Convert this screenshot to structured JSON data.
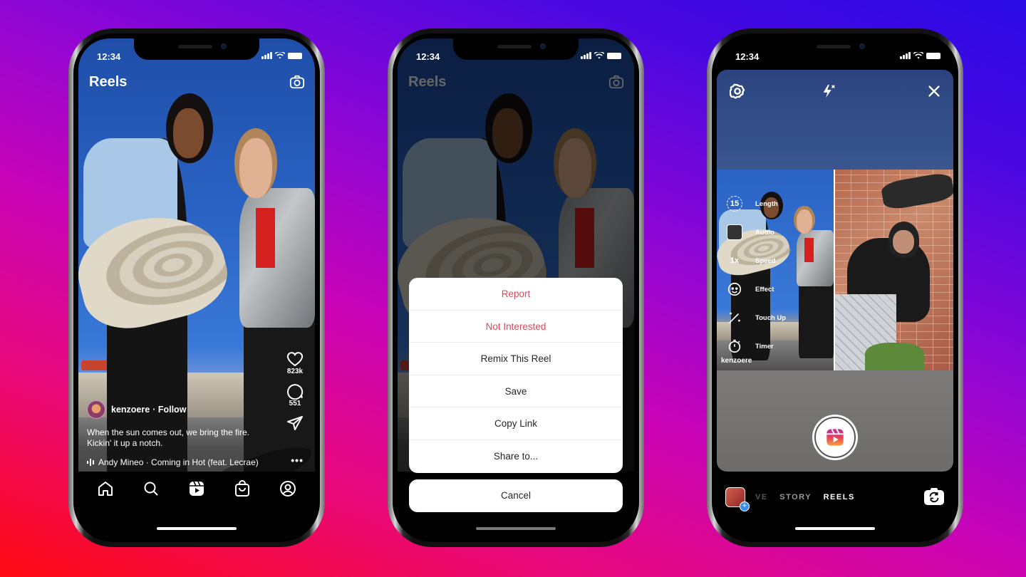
{
  "background": {
    "gradient_colors": [
      "#ff0a10",
      "#e8087a",
      "#c804b8",
      "#8a06d6",
      "#4a08e0",
      "#2a0ae6"
    ]
  },
  "phones": [
    {
      "status": {
        "time": "12:34"
      },
      "header": {
        "title": "Reels",
        "camera_icon": "camera-icon"
      },
      "actions": [
        {
          "icon": "heart-icon",
          "count": "823k"
        },
        {
          "icon": "comment-icon",
          "count": "551"
        },
        {
          "icon": "send-icon",
          "count": ""
        }
      ],
      "post": {
        "username": "kenzoere",
        "follow_label": "· Follow",
        "caption_line1": "When the sun comes out, we bring the fire.",
        "caption_line2": "Kickin' it up a notch.",
        "music": "Andy Mineo · Coming in Hot (feat. Lecrae)",
        "more": "•••"
      },
      "nav": [
        "home-icon",
        "search-icon",
        "reels-icon",
        "shop-icon",
        "profile-icon"
      ]
    },
    {
      "status": {
        "time": "12:34"
      },
      "header": {
        "title": "Reels"
      },
      "sheet": {
        "options": [
          {
            "label": "Report",
            "style": "destructive"
          },
          {
            "label": "Not Interested",
            "style": "destructive"
          },
          {
            "label": "Remix This Reel",
            "style": "default"
          },
          {
            "label": "Save",
            "style": "default"
          },
          {
            "label": "Copy Link",
            "style": "default"
          },
          {
            "label": "Share to...",
            "style": "default"
          }
        ],
        "cancel_label": "Cancel",
        "destructive_color": "#d64b5c"
      }
    },
    {
      "status": {
        "time": "12:34"
      },
      "camera": {
        "top_icons": [
          "settings-icon",
          "flash-off-icon",
          "close-icon"
        ],
        "tools": [
          {
            "icon": "length-icon",
            "icon_text": "15",
            "label": "Length"
          },
          {
            "icon": "audio-icon",
            "icon_text": "",
            "label": "Audio"
          },
          {
            "icon": "speed-icon",
            "icon_text": "1x",
            "label": "Speed"
          },
          {
            "icon": "effect-icon",
            "icon_text": "",
            "label": "Effect"
          },
          {
            "icon": "touch-up-icon",
            "icon_text": "",
            "label": "Touch Up"
          },
          {
            "icon": "timer-icon",
            "icon_text": "",
            "label": "Timer"
          }
        ],
        "remix_username": "kenzoere",
        "modes": [
          {
            "label": "LIVE",
            "visible_text": "VE",
            "active": false
          },
          {
            "label": "STORY",
            "visible_text": "STORY",
            "active": false
          },
          {
            "label": "REELS",
            "visible_text": "REELS",
            "active": true
          }
        ]
      }
    }
  ]
}
